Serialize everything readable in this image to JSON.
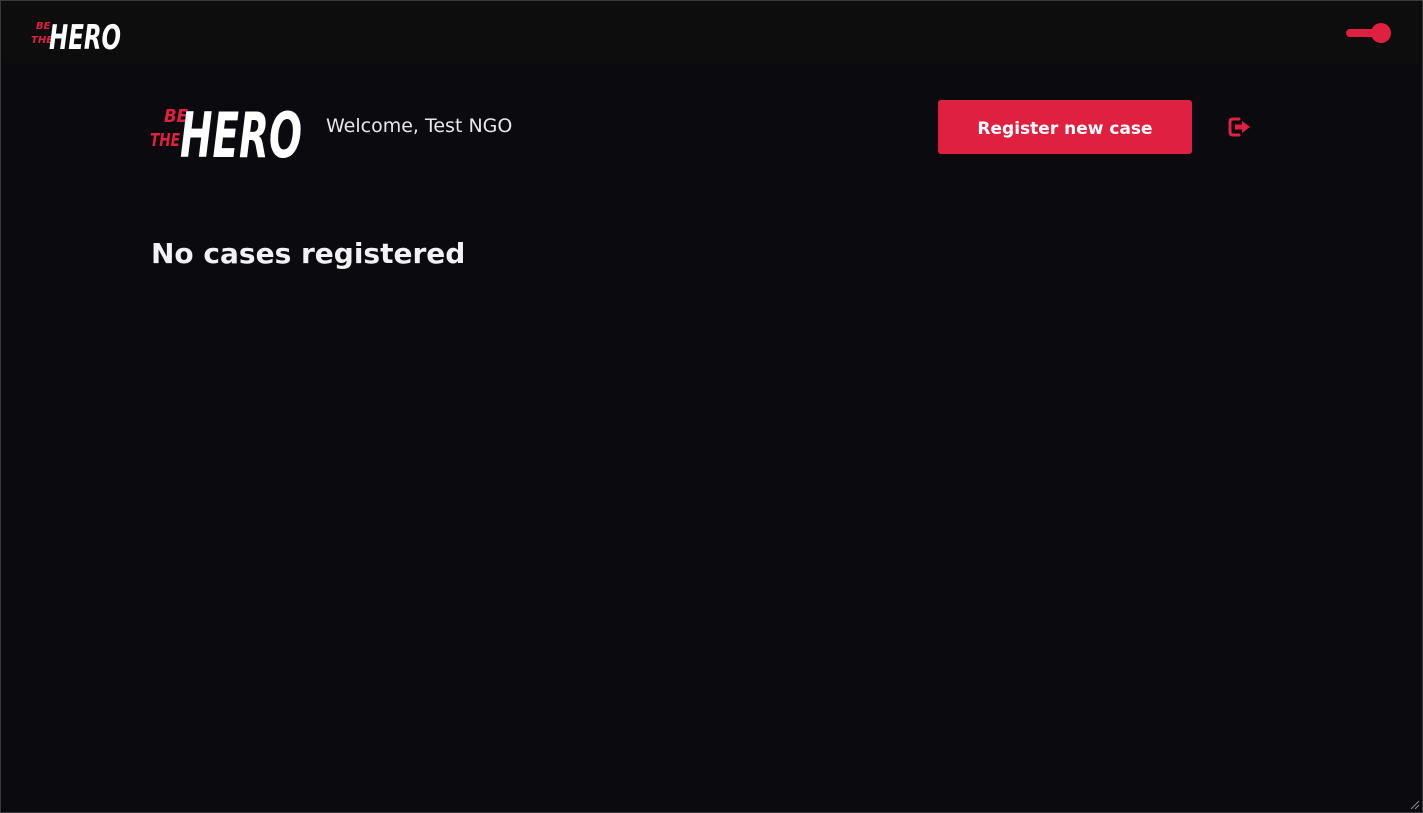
{
  "app": {
    "brand": "BE THE HERO",
    "colors": {
      "accent": "#e02041",
      "background": "#0b0a0e",
      "topbar": "#0d0d0d",
      "text": "#f2f2f5"
    }
  },
  "topbar": {
    "logo": {
      "line1": "BE",
      "line2": "THE",
      "word": "HERO"
    },
    "theme_toggle": {
      "state": "on",
      "icon": "toggle-switch"
    }
  },
  "header": {
    "logo": {
      "line1": "BE",
      "line2": "THE",
      "word": "HERO"
    },
    "welcome": "Welcome, Test NGO",
    "register_button": "Register new case",
    "logout_icon": "logout-icon"
  },
  "main": {
    "empty_message": "No cases registered"
  }
}
